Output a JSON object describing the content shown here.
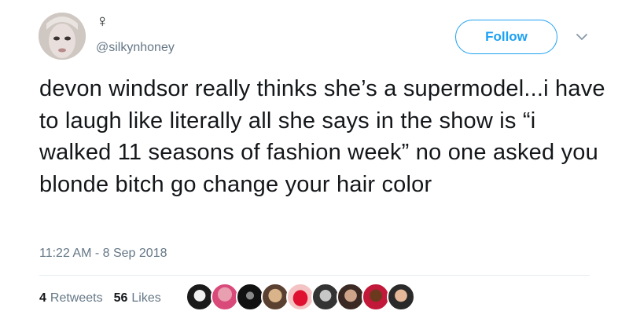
{
  "author": {
    "display_name": "♀",
    "handle": "@silkynhoney"
  },
  "follow_label": "Follow",
  "tweet_text": "devon windsor really thinks she’s a supermodel...i have to laugh like literally all she says in the show is “i walked 11 seasons of fashion week” no one asked you blonde bitch go change your hair color",
  "timestamp": "11:22 AM - 8 Sep 2018",
  "stats": {
    "retweets_count": "4",
    "retweets_label": "Retweets",
    "likes_count": "56",
    "likes_label": "Likes"
  },
  "colors": {
    "accent": "#1da1f2",
    "secondary_text": "#657786",
    "divider": "#e6ecf0"
  },
  "icons": [
    "chevron-down-icon"
  ]
}
